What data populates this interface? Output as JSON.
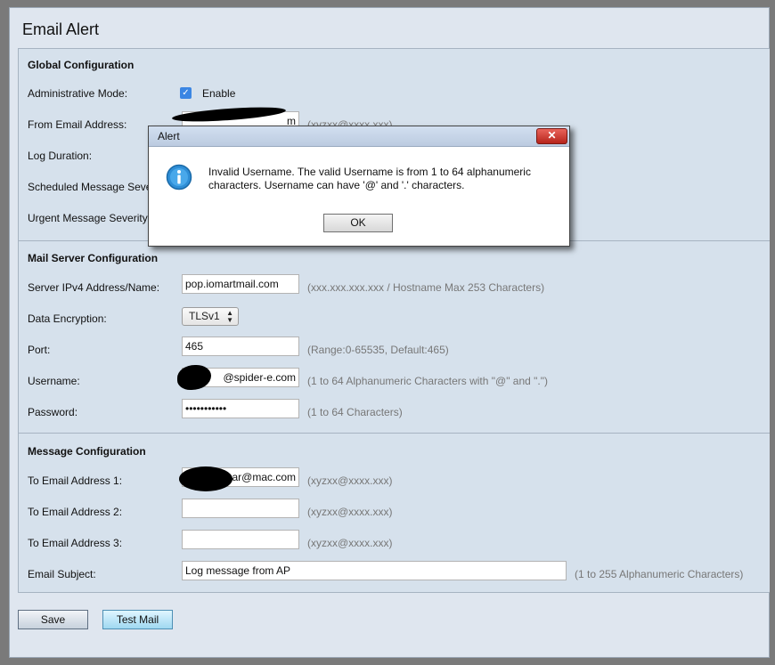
{
  "page_title": "Email Alert",
  "global": {
    "heading": "Global Configuration",
    "admin_mode_label": "Administrative Mode:",
    "admin_mode_checked": true,
    "enable_label": "Enable",
    "from_email_label": "From Email Address:",
    "from_email_value": "m",
    "from_email_hint": "(xyzxx@xxxx.xxx)",
    "log_duration_label": "Log Duration:",
    "scheduled_label": "Scheduled Message Seve",
    "urgent_label": "Urgent Message Severity"
  },
  "mail_server": {
    "heading": "Mail Server Configuration",
    "server_label": "Server IPv4 Address/Name:",
    "server_value": "pop.iomartmail.com",
    "server_hint": "(xxx.xxx.xxx.xxx / Hostname Max 253 Characters)",
    "encryption_label": "Data Encryption:",
    "encryption_value": "TLSv1",
    "port_label": "Port:",
    "port_value": "465",
    "port_hint": "(Range:0-65535, Default:465)",
    "username_label": "Username:",
    "username_value": "@spider-e.com",
    "username_hint": "(1 to 64 Alphanumeric Characters with \"@\" and \".\")",
    "password_label": "Password:",
    "password_value": "•••••••••••",
    "password_hint": "(1 to 64 Characters)"
  },
  "message": {
    "heading": "Message Configuration",
    "to1_label": "To Email Address 1:",
    "to1_value": "ar@mac.com",
    "to1_hint": "(xyzxx@xxxx.xxx)",
    "to2_label": "To Email Address 2:",
    "to2_value": "",
    "to2_hint": "(xyzxx@xxxx.xxx)",
    "to3_label": "To Email Address 3:",
    "to3_value": "",
    "to3_hint": "(xyzxx@xxxx.xxx)",
    "subject_label": "Email Subject:",
    "subject_value": "Log message from AP",
    "subject_hint": "(1 to 255 Alphanumeric Characters)"
  },
  "buttons": {
    "save": "Save",
    "test_mail": "Test Mail"
  },
  "alert": {
    "title": "Alert",
    "close_glyph": "✕",
    "message": "Invalid Username. The valid Username is from 1 to 64 alphanumeric characters. Username can have '@' and '.' characters.",
    "ok": "OK"
  },
  "icons": {
    "checkbox": "checkmark-icon",
    "dialog": "info-icon",
    "select_arrows": "up-down-arrows-icon"
  },
  "colors": {
    "page_bg": "#dfe6ef",
    "panel_bg": "#d6e1ec",
    "accent": "#3b86e3",
    "close_button": "#c9342b"
  }
}
